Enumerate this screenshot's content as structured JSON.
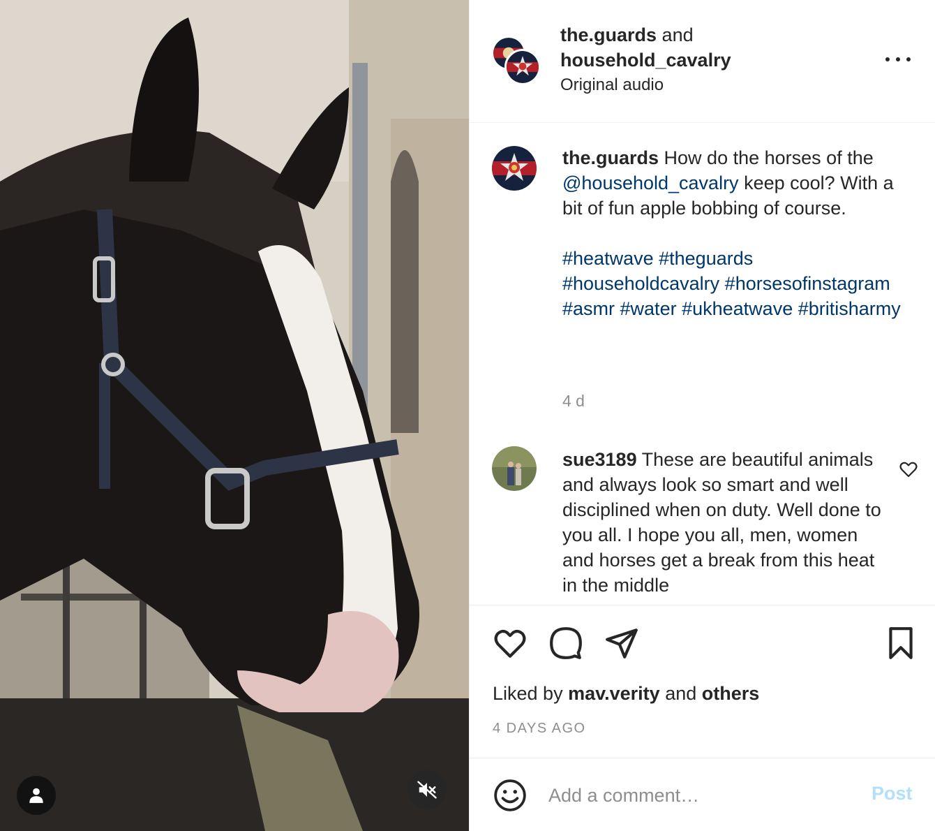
{
  "media": {
    "user_tag_icon": "person-icon",
    "mute_icon": "speaker-muted-icon"
  },
  "header": {
    "account1": "the.guards",
    "joiner": "and",
    "account2": "household_cavalry",
    "audio": "Original audio"
  },
  "caption": {
    "username": "the.guards",
    "text_before": "How do the horses of the",
    "mention": "@household_cavalry",
    "text_after": "keep cool? With a bit of fun apple bobbing of course.",
    "hashtags": [
      "#heatwave",
      "#theguards",
      "#householdcavalry",
      "#horsesofinstagram",
      "#asmr",
      "#water",
      "#ukheatwave",
      "#britisharmy"
    ],
    "time": "4 d"
  },
  "comment": {
    "username": "sue3189",
    "text": "These are beautiful animals and always look so smart and well disciplined when on duty. Well done to you all. I hope you all, men, women and horses get a break from this heat in the middle"
  },
  "actions": {
    "liked_prefix": "Liked by",
    "liked_user": "mav.verity",
    "liked_and": "and",
    "liked_others": "others",
    "date": "4 DAYS AGO"
  },
  "composer": {
    "placeholder": "Add a comment…",
    "post_label": "Post"
  },
  "colors": {
    "link": "#00376b",
    "post_disabled": "#b2dffc",
    "secondary_text": "#8e8e8e"
  }
}
